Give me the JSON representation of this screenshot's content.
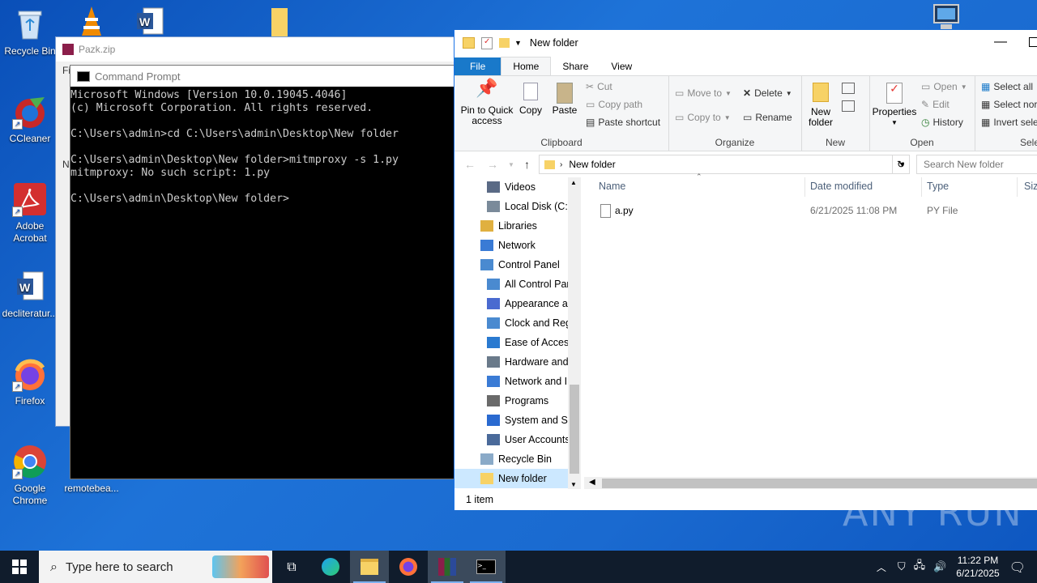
{
  "desktop": {
    "icons": [
      {
        "label": "Recycle Bin",
        "icon": "recycle-bin-icon"
      },
      {
        "label": "CCleaner",
        "icon": "ccleaner-icon"
      },
      {
        "label": "Adobe Acrobat",
        "icon": "adobe-acrobat-icon"
      },
      {
        "label": "decliteratur...",
        "icon": "word-document-icon"
      },
      {
        "label": "Firefox",
        "icon": "firefox-icon"
      },
      {
        "label": "Google Chrome",
        "icon": "chrome-icon"
      },
      {
        "label": "remotebea...",
        "icon": "file-icon"
      }
    ]
  },
  "pazk_window": {
    "title": "Pazk.zip",
    "side_letters": [
      "Fi",
      "N"
    ]
  },
  "cmd": {
    "title": "Command Prompt",
    "lines": [
      "Microsoft Windows [Version 10.0.19045.4046]",
      "(c) Microsoft Corporation. All rights reserved.",
      "",
      "C:\\Users\\admin>cd C:\\Users\\admin\\Desktop\\New folder",
      "",
      "C:\\Users\\admin\\Desktop\\New folder>mitmproxy -s 1.py",
      "mitmproxy: No such script: 1.py",
      "",
      "C:\\Users\\admin\\Desktop\\New folder>"
    ]
  },
  "explorer": {
    "title": "New folder",
    "tabs": [
      "File",
      "Home",
      "Share",
      "View"
    ],
    "ribbon": {
      "clipboard": {
        "label": "Clipboard",
        "pin": "Pin to Quick access",
        "copy": "Copy",
        "paste": "Paste",
        "cut": "Cut",
        "copy_path": "Copy path",
        "paste_shortcut": "Paste shortcut"
      },
      "organize": {
        "label": "Organize",
        "move_to": "Move to",
        "copy_to": "Copy to",
        "delete": "Delete",
        "rename": "Rename"
      },
      "new": {
        "label": "New",
        "new_folder": "New folder"
      },
      "open": {
        "label": "Open",
        "properties": "Properties",
        "open": "Open",
        "edit": "Edit",
        "history": "History"
      },
      "select": {
        "label": "Select",
        "select_all": "Select all",
        "select_none": "Select nor",
        "invert": "Invert sele"
      }
    },
    "address": {
      "path": "New folder",
      "search_placeholder": "Search New folder"
    },
    "nav": [
      {
        "label": "Videos",
        "indent": 2,
        "icon": "videos-icon"
      },
      {
        "label": "Local Disk (C:)",
        "indent": 2,
        "icon": "disk-icon"
      },
      {
        "label": "Libraries",
        "indent": 1,
        "icon": "libraries-icon"
      },
      {
        "label": "Network",
        "indent": 1,
        "icon": "network-icon"
      },
      {
        "label": "Control Panel",
        "indent": 1,
        "icon": "control-panel-icon"
      },
      {
        "label": "All Control Par",
        "indent": 2,
        "icon": "control-panel-icon"
      },
      {
        "label": "Appearance an",
        "indent": 2,
        "icon": "appearance-icon"
      },
      {
        "label": "Clock and Regi",
        "indent": 2,
        "icon": "clock-icon"
      },
      {
        "label": "Ease of Access",
        "indent": 2,
        "icon": "ease-of-access-icon"
      },
      {
        "label": "Hardware and",
        "indent": 2,
        "icon": "hardware-icon"
      },
      {
        "label": "Network and Ir",
        "indent": 2,
        "icon": "network-icon"
      },
      {
        "label": "Programs",
        "indent": 2,
        "icon": "programs-icon"
      },
      {
        "label": "System and Se",
        "indent": 2,
        "icon": "system-icon"
      },
      {
        "label": "User Accounts",
        "indent": 2,
        "icon": "user-accounts-icon"
      },
      {
        "label": "Recycle Bin",
        "indent": 1,
        "icon": "recycle-bin-icon"
      },
      {
        "label": "New folder",
        "indent": 1,
        "icon": "folder-icon",
        "selected": true
      }
    ],
    "columns": [
      "Name",
      "Date modified",
      "Type",
      "Size"
    ],
    "files": [
      {
        "name": "a.py",
        "date": "6/21/2025 11:08 PM",
        "type": "PY File"
      }
    ],
    "status": "1 item"
  },
  "taskbar": {
    "search_placeholder": "Type here to search",
    "time": "11:22 PM",
    "date": "6/21/2025"
  },
  "watermark": "ANY RUN"
}
